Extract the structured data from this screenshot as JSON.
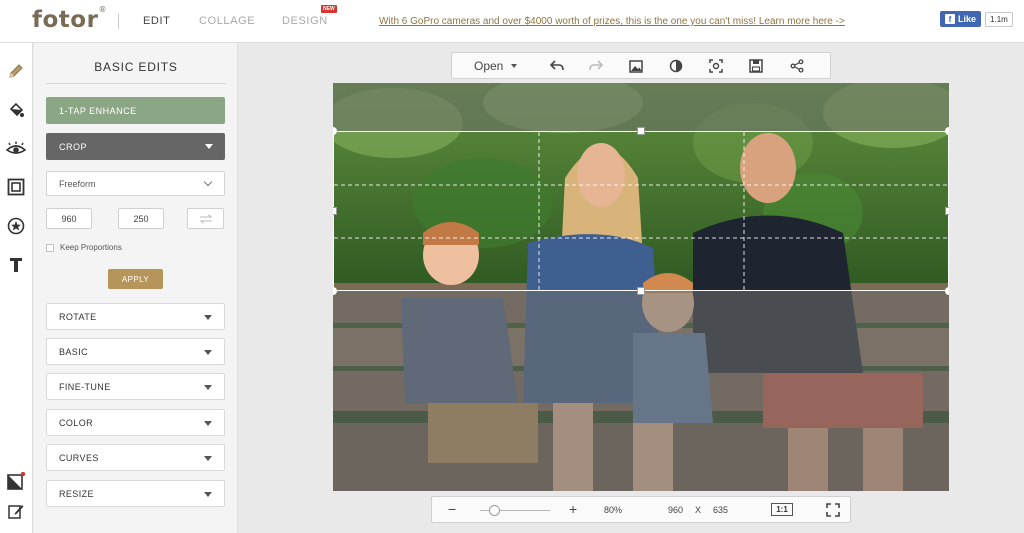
{
  "brand": {
    "logo": "fotor",
    "reg": "®"
  },
  "nav": {
    "edit": "EDIT",
    "collage": "COLLAGE",
    "design": "DESIGN",
    "new_badge": "NEW"
  },
  "promo": "With 6 GoPro cameras and over $4000 worth of prizes, this is the one you can't miss! Learn more here ->",
  "facebook": {
    "like": "Like",
    "count": "1.1m"
  },
  "panel": {
    "title": "BASIC EDITS",
    "enhance": "1-TAP ENHANCE",
    "crop": "CROP",
    "crop_mode": "Freeform",
    "width": "960",
    "height": "250",
    "times": "×",
    "keep_proportions": "Keep Proportions",
    "apply": "APPLY",
    "sections": [
      "ROTATE",
      "BASIC",
      "FINE-TUNE",
      "COLOR",
      "CURVES",
      "RESIZE"
    ]
  },
  "toolbar": {
    "open": "Open",
    "icons": [
      "undo-icon",
      "redo-icon",
      "image-icon",
      "contrast-icon",
      "focus-icon",
      "save-icon",
      "share-icon"
    ]
  },
  "zoom": {
    "minus": "−",
    "plus": "+",
    "percent": "80%",
    "width": "960",
    "x": "X",
    "height": "635",
    "ratio": "1:1"
  },
  "colors": {
    "enhance": "#8aa685",
    "crop": "#666666",
    "apply": "#b6955a",
    "brand": "#7a6a55",
    "promo": "#8f7541"
  },
  "rail_icons": [
    "pencil-icon",
    "paint-bucket-icon",
    "eye-icon",
    "frame-icon",
    "sticker-icon",
    "text-icon",
    "crop-corner-icon",
    "edit-note-icon"
  ]
}
